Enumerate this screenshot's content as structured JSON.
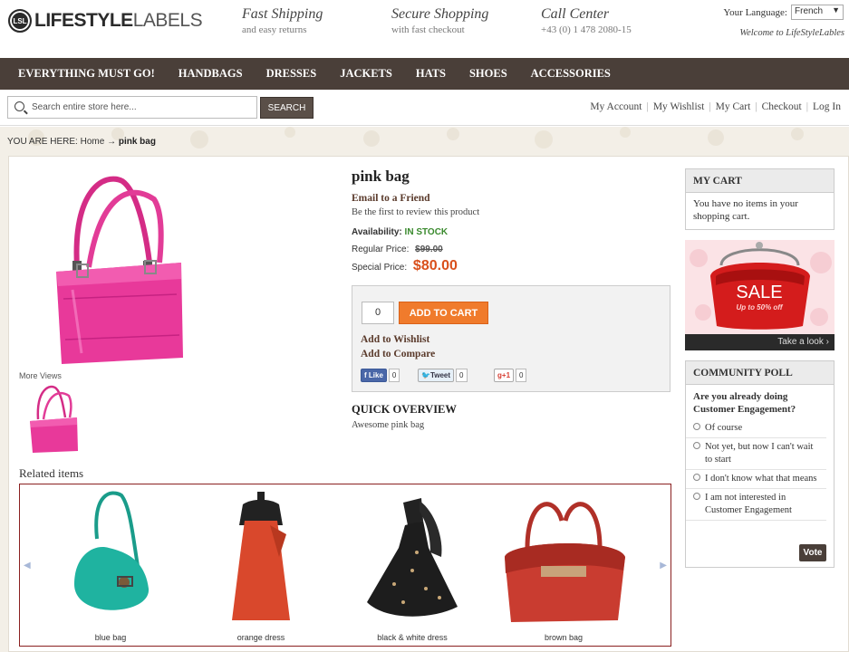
{
  "header": {
    "logo_bold": "LIFESTYLE",
    "logo_light": "LABELS",
    "logo_mark": "LSL",
    "usps": [
      {
        "title": "Fast Shipping",
        "sub": "and easy returns"
      },
      {
        "title": "Secure Shopping",
        "sub": "with fast checkout"
      },
      {
        "title": "Call Center",
        "sub": "+43 (0) 1 478 2080-15"
      }
    ],
    "language_label": "Your Language:",
    "language_value": "French",
    "welcome": "Welcome to LifeStyleLables"
  },
  "nav": [
    "EVERYTHING MUST GO!",
    "HANDBAGS",
    "DRESSES",
    "JACKETS",
    "HATS",
    "SHOES",
    "ACCESSORIES"
  ],
  "search": {
    "placeholder": "Search entire store here...",
    "button": "SEARCH"
  },
  "toplinks": [
    "My Account",
    "My Wishlist",
    "My Cart",
    "Checkout",
    "Log In"
  ],
  "breadcrumb": {
    "label": "YOU ARE HERE:",
    "home": "Home",
    "arrow": "→",
    "current": "pink bag"
  },
  "product": {
    "name": "pink bag",
    "email_friend": "Email to a Friend",
    "review": "Be the first to review this product",
    "availability_label": "Availability:",
    "availability_value": "IN STOCK",
    "regular_label": "Regular Price:",
    "regular_price": "$99.00",
    "special_label": "Special Price:",
    "special_price": "$80.00",
    "more_views": "More Views",
    "qty": "0",
    "add_to_cart": "ADD TO CART",
    "add_wishlist": "Add to Wishlist",
    "add_compare": "Add to Compare",
    "fb_label": "Like",
    "fb_count": "0",
    "tw_label": "Tweet",
    "tw_count": "0",
    "gp_label": "+1",
    "gp_count": "0",
    "overview_title": "QUICK OVERVIEW",
    "overview_text": "Awesome pink bag",
    "colors": {
      "bag": "#e8399a",
      "price": "#d9501c",
      "stock": "#3a8a2e"
    }
  },
  "sidebar": {
    "cart_title": "MY CART",
    "cart_empty": "You have no items in your shopping cart.",
    "sale_text": "SALE",
    "sale_sub": "Up to 50% off",
    "sale_link": "Take a look",
    "poll_title": "COMMUNITY POLL",
    "poll_question": "Are you already doing Customer Engagement?",
    "poll_options": [
      "Of course",
      "Not yet, but now I can't wait to start",
      "I don't know what that means",
      "I am not interested in Customer Engagement"
    ],
    "vote": "Vote"
  },
  "related": {
    "title": "Related items",
    "items": [
      "blue bag",
      "orange dress",
      "black & white dress",
      "brown bag"
    ]
  }
}
